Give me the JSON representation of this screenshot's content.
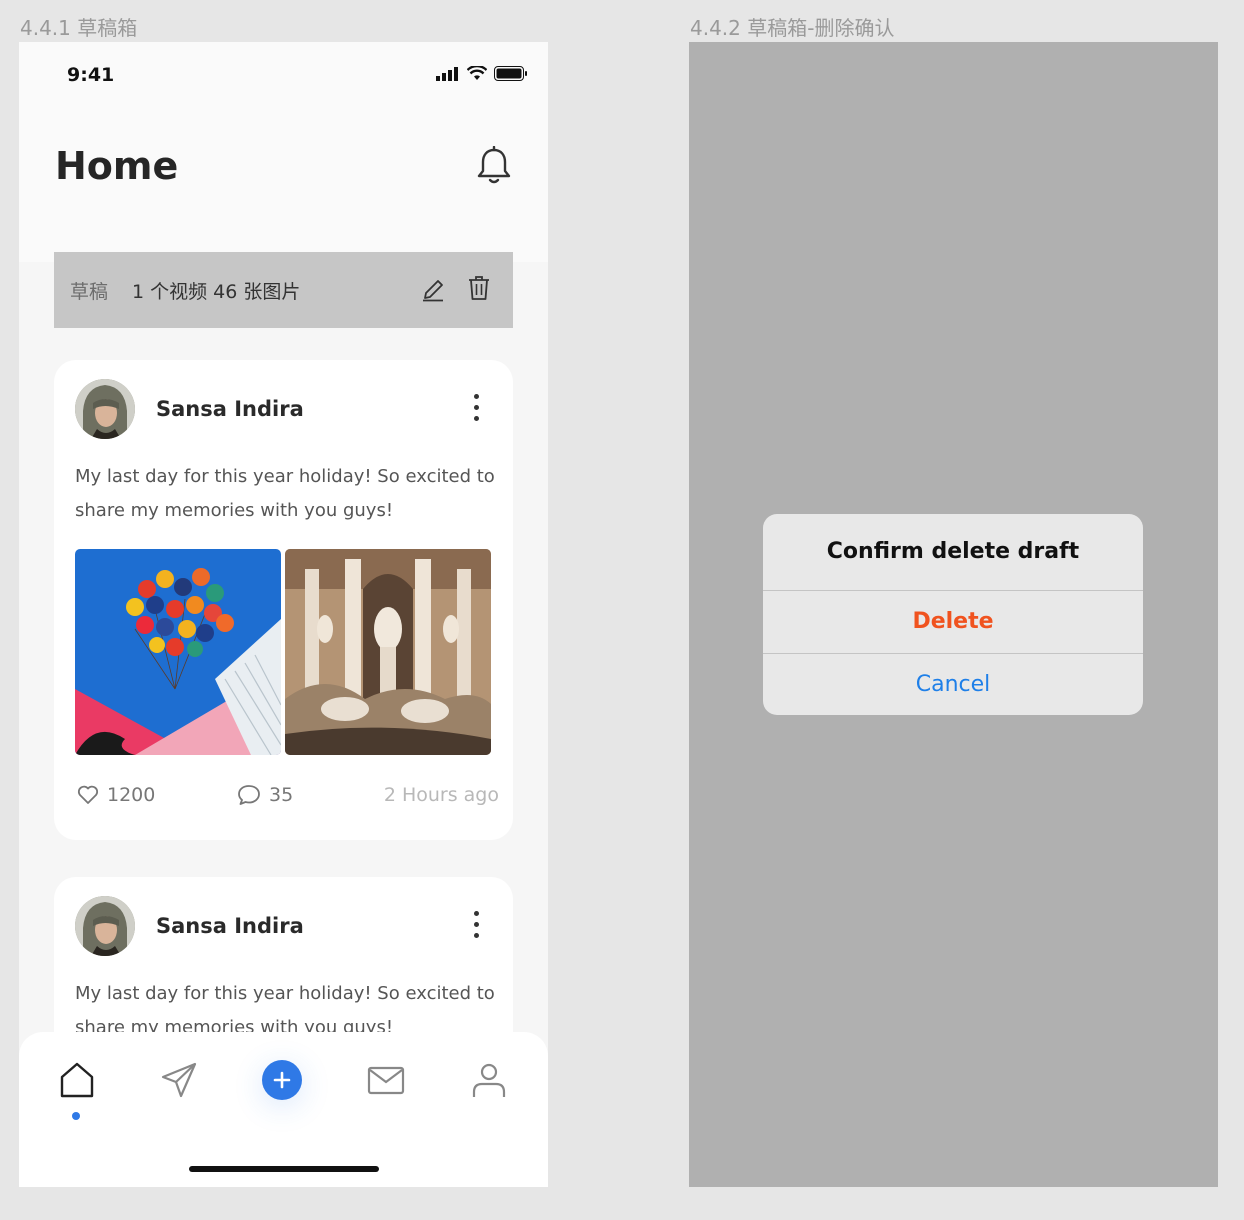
{
  "frames": {
    "left_label": "4.4.1 草稿箱",
    "right_label": "4.4.2 草稿箱-删除确认"
  },
  "status_bar": {
    "time": "9:41"
  },
  "header": {
    "title": "Home"
  },
  "draft": {
    "label": "草稿",
    "info": "1 个视频 46 张图片"
  },
  "posts": [
    {
      "author": "Sansa Indira",
      "text": "My last day for this year holiday! So excited to share my memories with you guys!",
      "likes": "1200",
      "comments": "35",
      "time": "2 Hours ago"
    },
    {
      "author": "Sansa Indira",
      "text": "My last day for this year holiday! So excited to share my memories with you guys!"
    }
  ],
  "tabs": {
    "active": "home",
    "add_symbol": "+"
  },
  "dialog": {
    "title": "Confirm delete draft",
    "delete_label": "Delete",
    "cancel_label": "Cancel"
  },
  "colors": {
    "accent": "#2f79e6",
    "danger": "#f0531f",
    "link": "#1e7fe8",
    "overlay": "#b0b0b0"
  }
}
